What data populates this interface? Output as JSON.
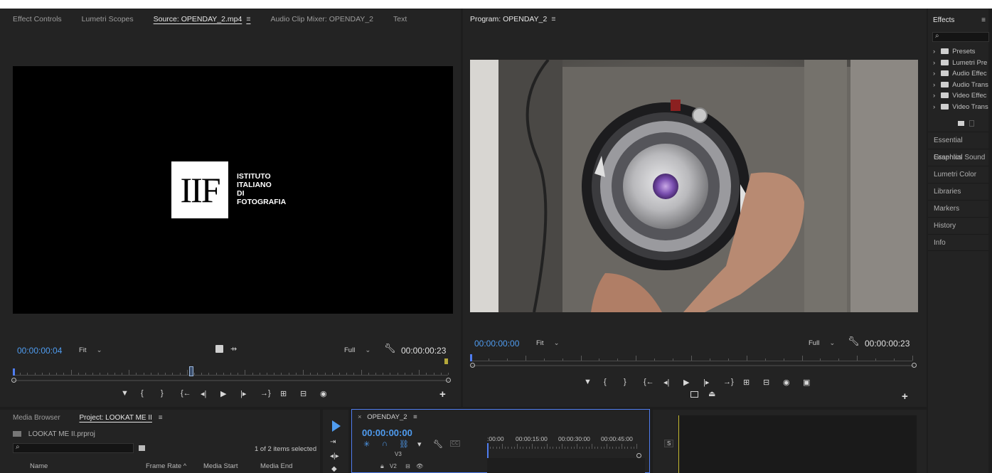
{
  "source_panel": {
    "tabs": [
      "Effect Controls",
      "Lumetri Scopes",
      "Source: OPENDAY_2.mp4",
      "Audio Clip Mixer: OPENDAY_2",
      "Text"
    ],
    "menu_icon": "≡",
    "logo": {
      "mark": "IIF",
      "lines": [
        "ISTITUTO",
        "ITALIANO",
        "DI",
        "FOTOGRAFIA"
      ]
    },
    "timecode_in": "00:00:00:04",
    "zoom": "Fit",
    "resolution": "Full",
    "timecode_out": "00:00:00:23",
    "add_glyph": "+"
  },
  "program_panel": {
    "title": "Program: OPENDAY_2",
    "menu_icon": "≡",
    "timecode_in": "00:00:00:00",
    "zoom": "Fit",
    "resolution": "Full",
    "timecode_out": "00:00:00:23",
    "add_glyph": "+"
  },
  "effects_panel": {
    "title": "Effects",
    "menu_icon": "≡",
    "search_placeholder": "",
    "tree": [
      "Presets",
      "Lumetri Pre",
      "Audio Effec",
      "Audio Trans",
      "Video Effec",
      "Video Trans"
    ],
    "collapsed_panels": [
      "Essential Graphics",
      "Essential Sound",
      "Lumetri Color",
      "Libraries",
      "Markers",
      "History",
      "Info"
    ]
  },
  "project_panel": {
    "tabs": [
      "Media Browser",
      "Project: LOOKAT ME II"
    ],
    "menu_icon": "≡",
    "project_file": "LOOKAT ME II.prproj",
    "selection_status": "1 of 2 items selected",
    "columns": [
      "Name",
      "Frame Rate",
      "Media Start",
      "Media End"
    ],
    "sort_indicator": "^"
  },
  "timeline_panel": {
    "close_glyph": "×",
    "sequence_name": "OPENDAY_2",
    "menu_icon": "≡",
    "timecode": "00:00:00:00",
    "ruler_labels": [
      ":00:00",
      "00:00:15:00",
      "00:00:30:00",
      "00:00:45:00"
    ],
    "tracks": [
      "V3",
      "V2"
    ],
    "cc_label": "CC"
  },
  "audio_meter": {
    "solo_label": "S"
  },
  "colors": {
    "timecode_blue": "#4f9cf0",
    "panel_bg": "#232323",
    "accent_yellow": "#b5a83a",
    "playhead": "#4f7df0"
  },
  "icons": [
    "search-icon",
    "menu-icon",
    "wrench-icon",
    "play-icon",
    "step-back-icon",
    "step-forward-icon",
    "mark-in-icon",
    "mark-out-icon",
    "go-to-in-icon",
    "go-to-out-icon",
    "insert-icon",
    "overwrite-icon",
    "export-frame-icon",
    "camera-icon",
    "folder-icon",
    "selection-tool-icon",
    "track-select-icon",
    "ripple-edit-icon",
    "razor-icon",
    "snap-icon",
    "linked-selection-icon",
    "add-marker-icon",
    "settings-wrench-icon",
    "lock-icon",
    "eye-icon"
  ]
}
